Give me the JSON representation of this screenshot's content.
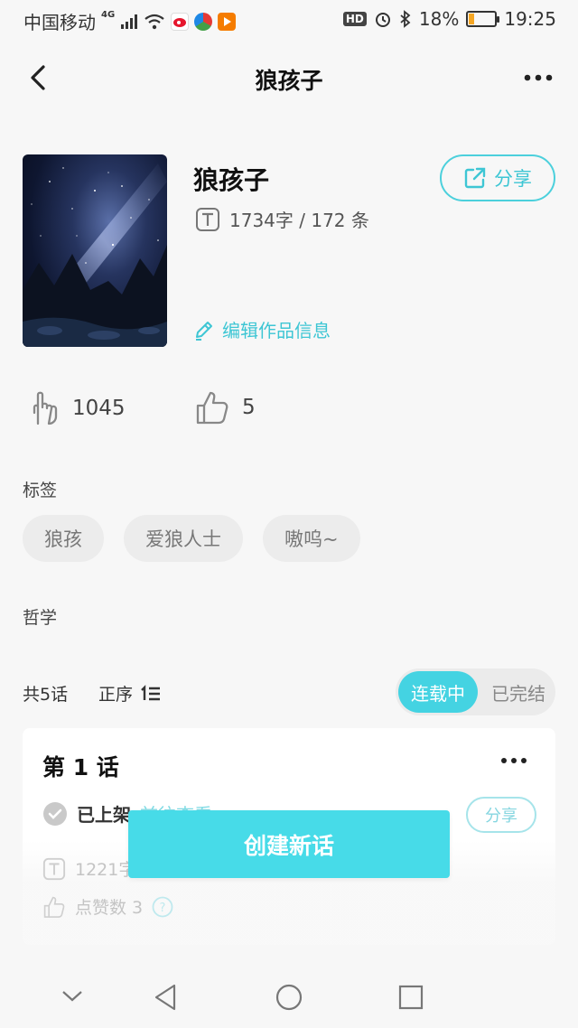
{
  "status_bar": {
    "carrier": "中国移动",
    "network": "4G",
    "battery_percent": "18%",
    "time": "19:25",
    "hd_badge": "HD",
    "battery_level": 0.18,
    "battery_color": "#f5a623"
  },
  "nav": {
    "title": "狼孩子",
    "back_icon": "chevron-left-icon",
    "more_icon": "more-horizontal-icon"
  },
  "work": {
    "title": "狼孩子",
    "word_count": "1734字 / 172 条",
    "share_label": "分享",
    "edit_label": "编辑作品信息"
  },
  "stats": {
    "read_count": "1045",
    "like_count": "5"
  },
  "tags": {
    "label": "标签",
    "items": [
      "狼孩",
      "爱狼人士",
      "嗷呜~"
    ]
  },
  "category": "哲学",
  "chapters": {
    "count_label": "共5话",
    "sort_label": "正序",
    "toggle_on": "连载中",
    "toggle_off": "已完结"
  },
  "chapter_card": {
    "title": "第 1 话",
    "status": "已上架",
    "link_text": "前往查看",
    "share_label": "分享",
    "word_count": "1221字",
    "likes_label": "点赞数 3"
  },
  "create_button": "创建新话",
  "colors": {
    "accent": "#44d3e2",
    "accent_text": "#3ec6d4"
  }
}
